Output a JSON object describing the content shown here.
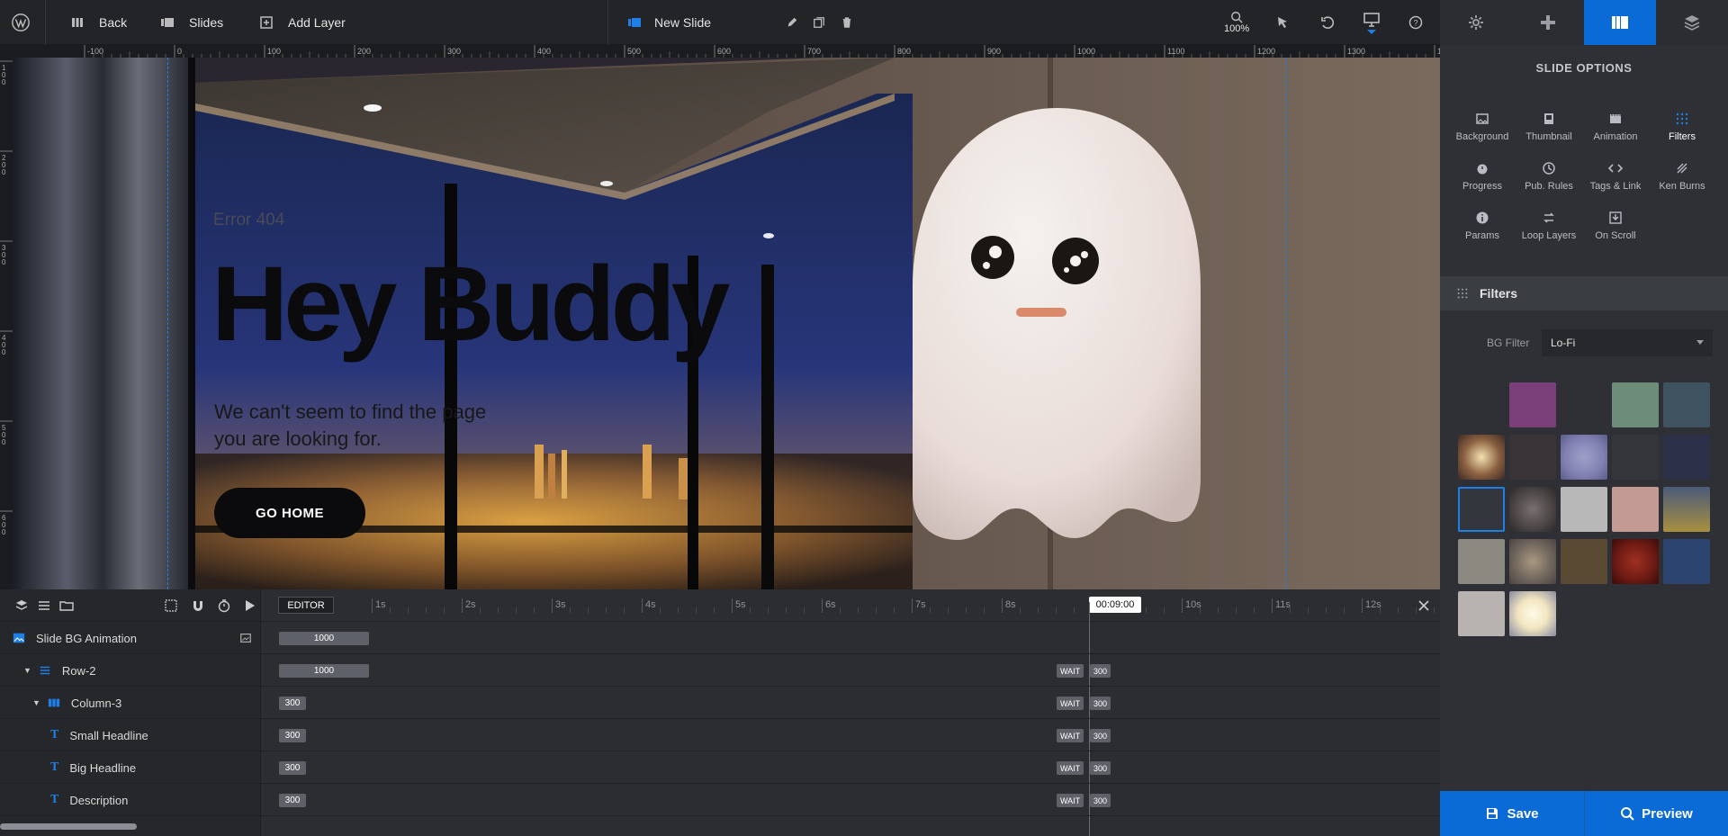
{
  "topbar": {
    "back_label": "Back",
    "slides_label": "Slides",
    "add_layer_label": "Add Layer",
    "slide_name": "New Slide",
    "zoom": "100%"
  },
  "ruler": {
    "top_ticks": [
      "-100",
      "0",
      "100",
      "200",
      "300",
      "400",
      "500",
      "600",
      "700",
      "800",
      "900",
      "1000",
      "1100",
      "1200",
      "1300",
      "14"
    ],
    "left_ticks": [
      "100",
      "200",
      "300",
      "400",
      "500",
      "600"
    ]
  },
  "canvas": {
    "small_headline": "Error 404",
    "big_headline": "Hey Buddy",
    "description_line1": "We can't seem to find the page",
    "description_line2": "you are looking for.",
    "button_label": "GO HOME"
  },
  "timeline": {
    "editor_label": "EDITOR",
    "ticks": [
      "1s",
      "2s",
      "3s",
      "4s",
      "5s",
      "6s",
      "7s",
      "8s",
      "9s",
      "10s",
      "11s",
      "12s"
    ],
    "current_time": "00:09:00",
    "rows": [
      {
        "label": "Slide BG Animation",
        "bar": "1000",
        "wait": "",
        "wait_val": ""
      },
      {
        "label": "Row-2",
        "bar": "1000",
        "wait": "WAIT",
        "wait_val": "300"
      },
      {
        "label": "Column-3",
        "bar": "300",
        "wait": "WAIT",
        "wait_val": "300"
      },
      {
        "label": "Small Headline",
        "bar": "300",
        "wait": "WAIT",
        "wait_val": "300"
      },
      {
        "label": "Big Headline",
        "bar": "300",
        "wait": "WAIT",
        "wait_val": "300"
      },
      {
        "label": "Description",
        "bar": "300",
        "wait": "WAIT",
        "wait_val": "300"
      }
    ]
  },
  "right_panel": {
    "header": "SLIDE OPTIONS",
    "options": [
      {
        "label": "Background",
        "icon": "image-icon"
      },
      {
        "label": "Thumbnail",
        "icon": "thumbnail-icon"
      },
      {
        "label": "Animation",
        "icon": "film-icon"
      },
      {
        "label": "Filters",
        "icon": "filters-icon",
        "active": true
      },
      {
        "label": "Progress",
        "icon": "stopwatch-icon"
      },
      {
        "label": "Pub. Rules",
        "icon": "clock-icon"
      },
      {
        "label": "Tags & Link",
        "icon": "code-icon"
      },
      {
        "label": "Ken Burns",
        "icon": "kenburns-icon"
      },
      {
        "label": "Params",
        "icon": "info-icon"
      },
      {
        "label": "Loop Layers",
        "icon": "loop-icon"
      },
      {
        "label": "On Scroll",
        "icon": "download-icon"
      }
    ],
    "section_title": "Filters",
    "bg_filter_label": "BG Filter",
    "bg_filter_value": "Lo-Fi",
    "swatch_colors": [
      "#2e3035",
      "#7a3f78",
      "#2e3035",
      "#6e8c7a",
      "#3e5260",
      "#8a6a4a",
      "#3a3438",
      "#7f80b0",
      "#34363b",
      "#2c3048",
      "#33363c",
      "#585050",
      "#b8b8b8",
      "#c49a94",
      "#6a7a6a",
      "#8c8a80",
      "#6e645c",
      "#5a4a34",
      "#6a1a14",
      "#2c4470",
      "#b8b2b0",
      "#d8c8a0"
    ],
    "save_label": "Save",
    "preview_label": "Preview"
  }
}
